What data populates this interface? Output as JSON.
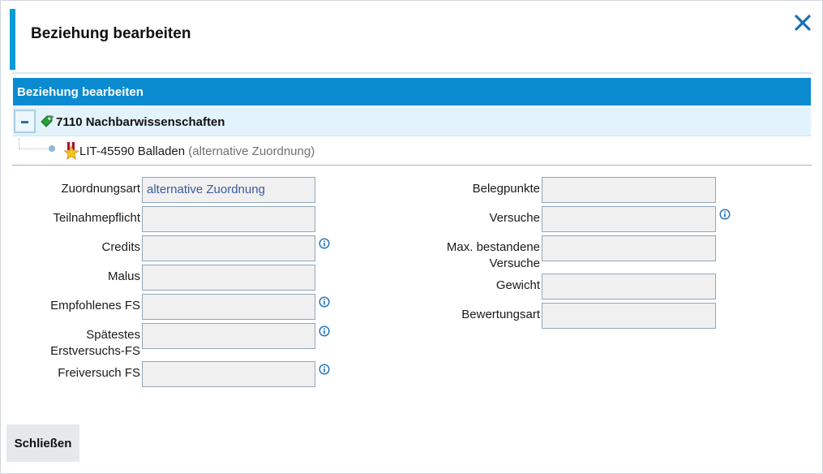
{
  "dialog": {
    "title": "Beziehung bearbeiten",
    "accent_color": "#0a9ad8",
    "close_icon": "close-icon"
  },
  "panel": {
    "title": "Beziehung bearbeiten",
    "bar_color": "#0a8bd0"
  },
  "tree": {
    "root": {
      "label": "7110 Nachbarwissenschaften",
      "icon": "tag-icon"
    },
    "child": {
      "label": "LIT-45590 Balladen",
      "note": "(alternative Zuordnung)",
      "icon": "star-icon"
    }
  },
  "form": {
    "left": [
      {
        "label": "Zuordnungsart",
        "value": "alternative Zuordnung",
        "info": false
      },
      {
        "label": "Teilnahmepflicht",
        "value": "",
        "info": false
      },
      {
        "label": "Credits",
        "value": "",
        "info": true
      },
      {
        "label": "Malus",
        "value": "",
        "info": false
      },
      {
        "label": "Empfohlenes FS",
        "value": "",
        "info": true
      },
      {
        "label_line1": "Spätestes",
        "label_line2": "Erstversuchs-FS",
        "value": "",
        "info": true
      },
      {
        "label": "Freiversuch FS",
        "value": "",
        "info": true
      }
    ],
    "right": [
      {
        "label": "Belegpunkte",
        "value": "",
        "info": false
      },
      {
        "label": "Versuche",
        "value": "",
        "info": true
      },
      {
        "label_line1": "Max. bestandene",
        "label_line2": "Versuche",
        "value": "",
        "info": false
      },
      {
        "label": "Gewicht",
        "value": "",
        "info": false
      },
      {
        "label": "Bewertungsart",
        "value": "",
        "info": false
      }
    ]
  },
  "footer": {
    "close_label": "Schließen"
  }
}
